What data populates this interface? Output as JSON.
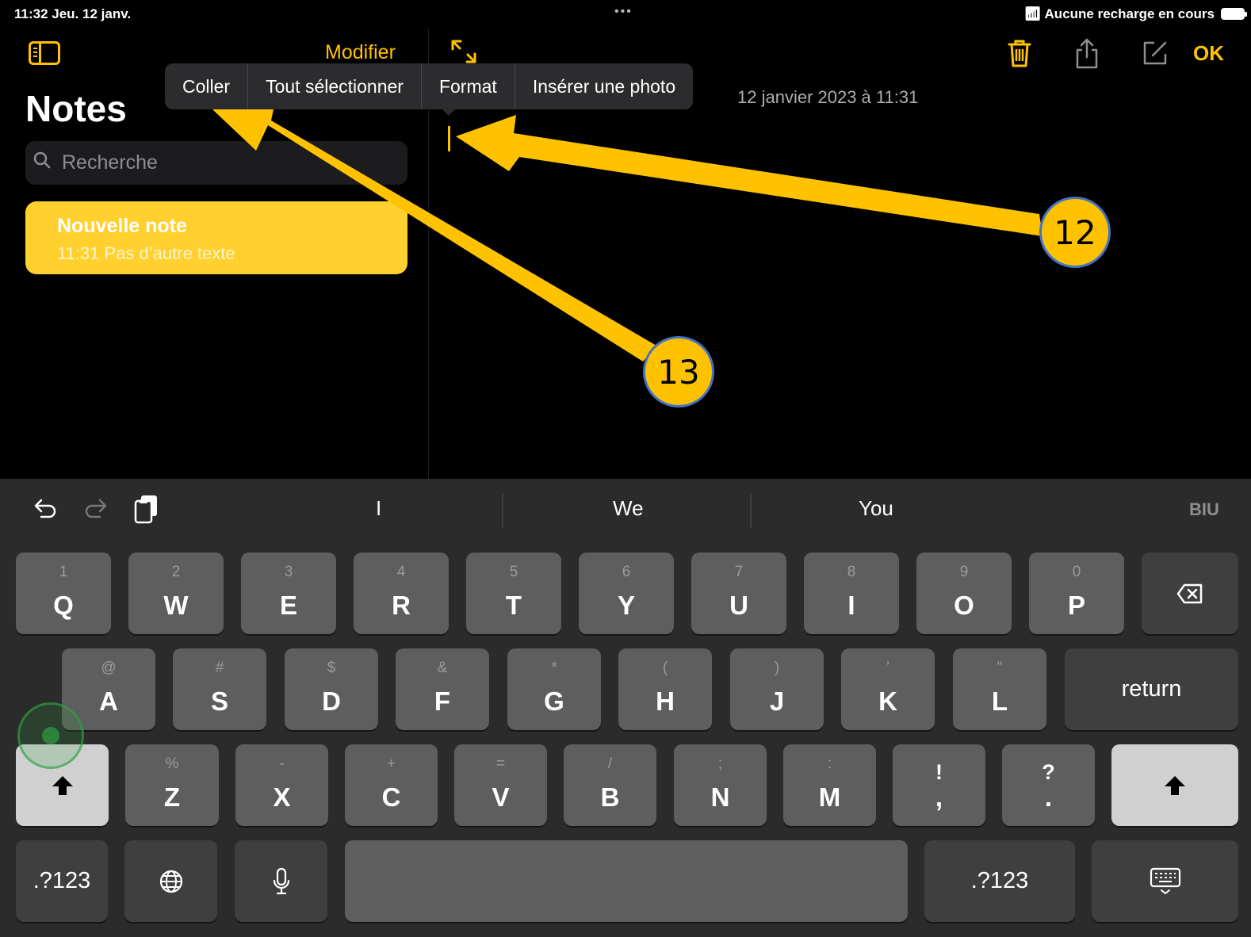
{
  "status_bar": {
    "time_date": "11:32  Jeu. 12 janv.",
    "dots": "•••",
    "charge_text": "Aucune recharge en cours"
  },
  "sidebar": {
    "edit_label": "Modifier",
    "title": "Notes",
    "search_placeholder": "Recherche",
    "notes": [
      {
        "title": "Nouvelle note",
        "meta": "11:31  Pas d’autre texte"
      }
    ]
  },
  "editor": {
    "ok_label": "OK",
    "date": "12 janvier 2023 à 11:31"
  },
  "context_menu": {
    "items": [
      "Coller",
      "Tout sélectionner",
      "Format",
      "Insérer une photo"
    ]
  },
  "annotations": {
    "callout_12": "12",
    "callout_13": "13"
  },
  "keyboard": {
    "suggestions": [
      "I",
      "We",
      "You"
    ],
    "format_label": "BIU",
    "row1": [
      {
        "hint": "1",
        "key": "Q"
      },
      {
        "hint": "2",
        "key": "W"
      },
      {
        "hint": "3",
        "key": "E"
      },
      {
        "hint": "4",
        "key": "R"
      },
      {
        "hint": "5",
        "key": "T"
      },
      {
        "hint": "6",
        "key": "Y"
      },
      {
        "hint": "7",
        "key": "U"
      },
      {
        "hint": "8",
        "key": "I"
      },
      {
        "hint": "9",
        "key": "O"
      },
      {
        "hint": "0",
        "key": "P"
      }
    ],
    "row2": [
      {
        "hint": "@",
        "key": "A"
      },
      {
        "hint": "#",
        "key": "S"
      },
      {
        "hint": "$",
        "key": "D"
      },
      {
        "hint": "&",
        "key": "F"
      },
      {
        "hint": "*",
        "key": "G"
      },
      {
        "hint": "(",
        "key": "H"
      },
      {
        "hint": ")",
        "key": "J"
      },
      {
        "hint": "’",
        "key": "K"
      },
      {
        "hint": "\"",
        "key": "L"
      }
    ],
    "row3": [
      {
        "hint": "%",
        "key": "Z"
      },
      {
        "hint": "-",
        "key": "X"
      },
      {
        "hint": "+",
        "key": "C"
      },
      {
        "hint": "=",
        "key": "V"
      },
      {
        "hint": "/",
        "key": "B"
      },
      {
        "hint": ";",
        "key": "N"
      },
      {
        "hint": ":",
        "key": "M"
      },
      {
        "hint": "!",
        "key": ","
      },
      {
        "hint": "?",
        "key": "."
      }
    ],
    "return_label": "return",
    "numbers_label": ".?123",
    "colors": {
      "accent": "#ffc200",
      "key": "#5e5e5e",
      "key_dark": "#3f3f3f",
      "shift": "#d0d0d0"
    }
  }
}
